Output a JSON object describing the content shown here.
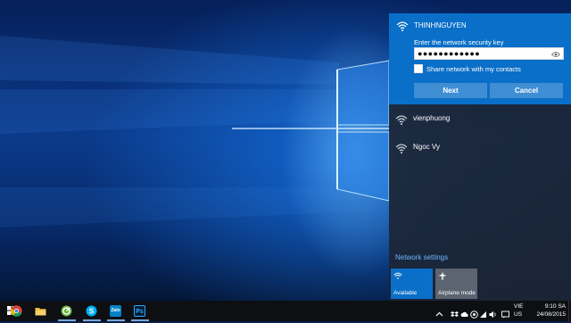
{
  "flyout": {
    "active_network": {
      "ssid": "THINHNGUYEN",
      "security_key_label": "Enter the network security key",
      "password_mask": "●●●●●●●●●●●●",
      "share_label": "Share network with my contacts",
      "share_checked": false,
      "next_label": "Next",
      "cancel_label": "Cancel"
    },
    "networks": [
      {
        "ssid": "vienphuong"
      },
      {
        "ssid": "Ngoc Vy"
      }
    ],
    "network_settings_label": "Network settings",
    "tiles": {
      "available_label": "Available",
      "airplane_label": "Airplane mode"
    }
  },
  "taskbar": {
    "apps": [
      {
        "name": "chrome-icon"
      },
      {
        "name": "file-explorer-icon"
      },
      {
        "name": "app-green-icon"
      },
      {
        "name": "skype-icon"
      },
      {
        "name": "zalo-icon",
        "text": "Zalo"
      },
      {
        "name": "photoshop-icon",
        "text": "Ps"
      }
    ],
    "language": {
      "line1": "VIE",
      "line2": "US"
    },
    "clock": {
      "time": "9:10 SA",
      "date": "24/08/2015"
    }
  },
  "colors": {
    "accent": "#0a6fc8",
    "flyout_bg": "#1c2636",
    "link": "#6fb6ff",
    "taskbar": "#0d0f12"
  }
}
